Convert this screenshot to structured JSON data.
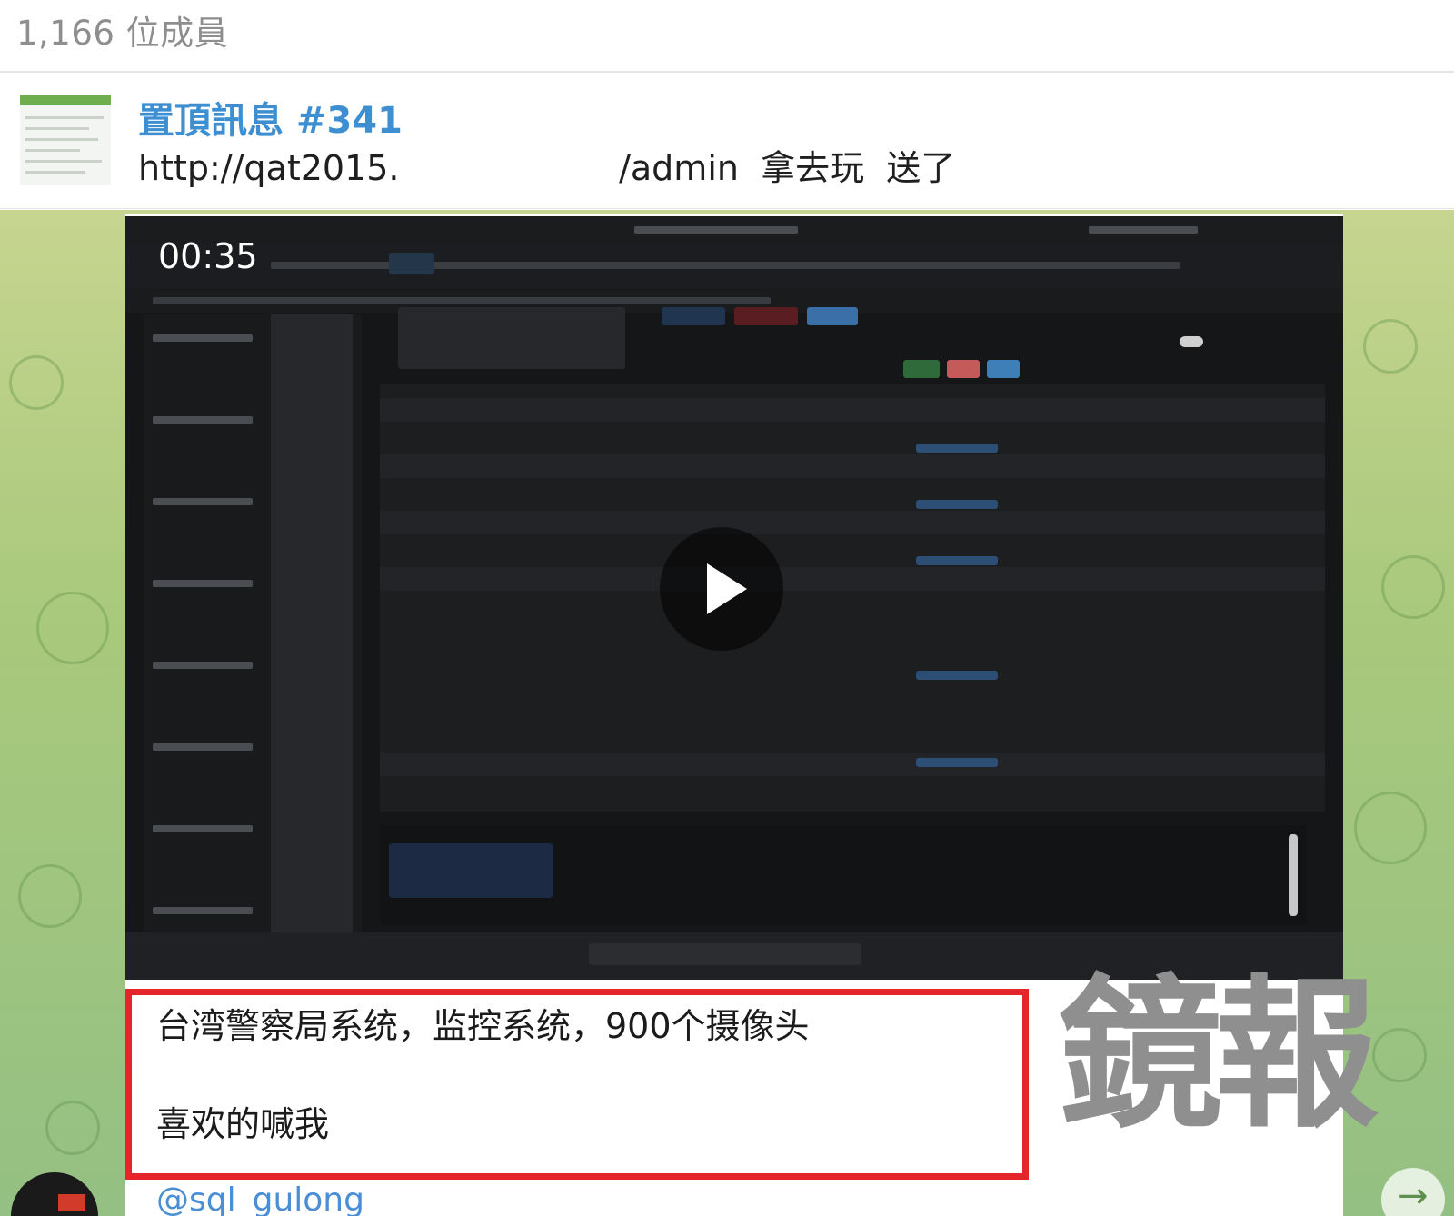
{
  "header": {
    "member_count": "1,166 位成員"
  },
  "pinned": {
    "title": "置頂訊息 #341",
    "text": "http://qat2015.                    /admin  拿去玩  送了"
  },
  "video": {
    "timestamp": "00:35",
    "play_icon": "play-icon"
  },
  "caption": {
    "line1": "台湾警察局系统，监控系统，900个摄像头",
    "line2": "喜欢的喊我"
  },
  "watermark": "鏡報",
  "sender": "@sql_gulong",
  "icons": {
    "forward": "arrow-right-icon",
    "avatar": "avatar"
  },
  "colors": {
    "accent_link": "#3d8fd1",
    "highlight_border": "#e4262b",
    "watermark": "#8f8f8f"
  }
}
